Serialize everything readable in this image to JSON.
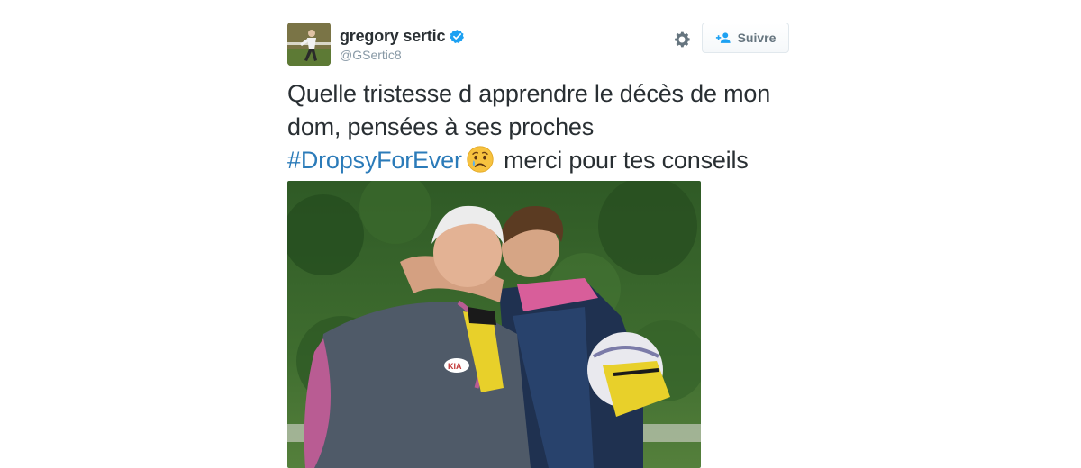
{
  "user": {
    "name": "gregory sertic",
    "handle": "@GSertic8",
    "verified": true
  },
  "follow_button": {
    "label": "Suivre"
  },
  "tweet": {
    "text_line_1": "Quelle tristesse d apprendre le décès de mon dom, pensées à ses proches",
    "hashtag": "#DropsyForEver",
    "text_after_emoji": "merci pour tes conseils",
    "emoji": "crying-face"
  },
  "colors": {
    "link": "#2b7bb9",
    "text": "#292f33",
    "muted": "#8899a6",
    "verified": "#1da1f2"
  },
  "icons": {
    "settings": "gear-icon",
    "follow": "add-user-icon",
    "verified": "verified-badge-icon"
  }
}
